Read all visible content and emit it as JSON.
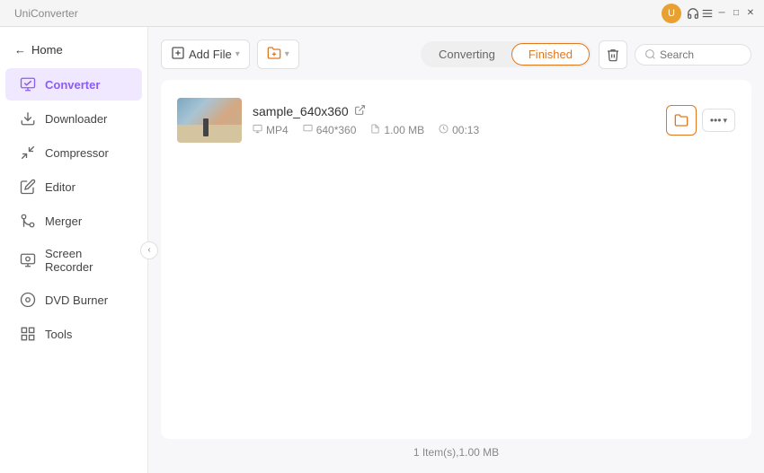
{
  "titlebar": {
    "minimize_label": "─",
    "maximize_label": "□",
    "close_label": "✕"
  },
  "sidebar": {
    "back_label": "Home",
    "items": [
      {
        "id": "converter",
        "label": "Converter",
        "active": true
      },
      {
        "id": "downloader",
        "label": "Downloader",
        "active": false
      },
      {
        "id": "compressor",
        "label": "Compressor",
        "active": false
      },
      {
        "id": "editor",
        "label": "Editor",
        "active": false
      },
      {
        "id": "merger",
        "label": "Merger",
        "active": false
      },
      {
        "id": "screen-recorder",
        "label": "Screen Recorder",
        "active": false
      },
      {
        "id": "dvd-burner",
        "label": "DVD Burner",
        "active": false
      },
      {
        "id": "tools",
        "label": "Tools",
        "active": false
      }
    ]
  },
  "toolbar": {
    "add_file_label": "Add File",
    "add_folder_label": "Add Folder"
  },
  "tabs": {
    "converting_label": "Converting",
    "finished_label": "Finished",
    "active": "finished"
  },
  "search": {
    "placeholder": "Search"
  },
  "file": {
    "name": "sample_640x360",
    "format": "MP4",
    "resolution": "640*360",
    "size": "1.00 MB",
    "duration": "00:13"
  },
  "status_bar": {
    "label": "1 Item(s),1.00 MB"
  }
}
